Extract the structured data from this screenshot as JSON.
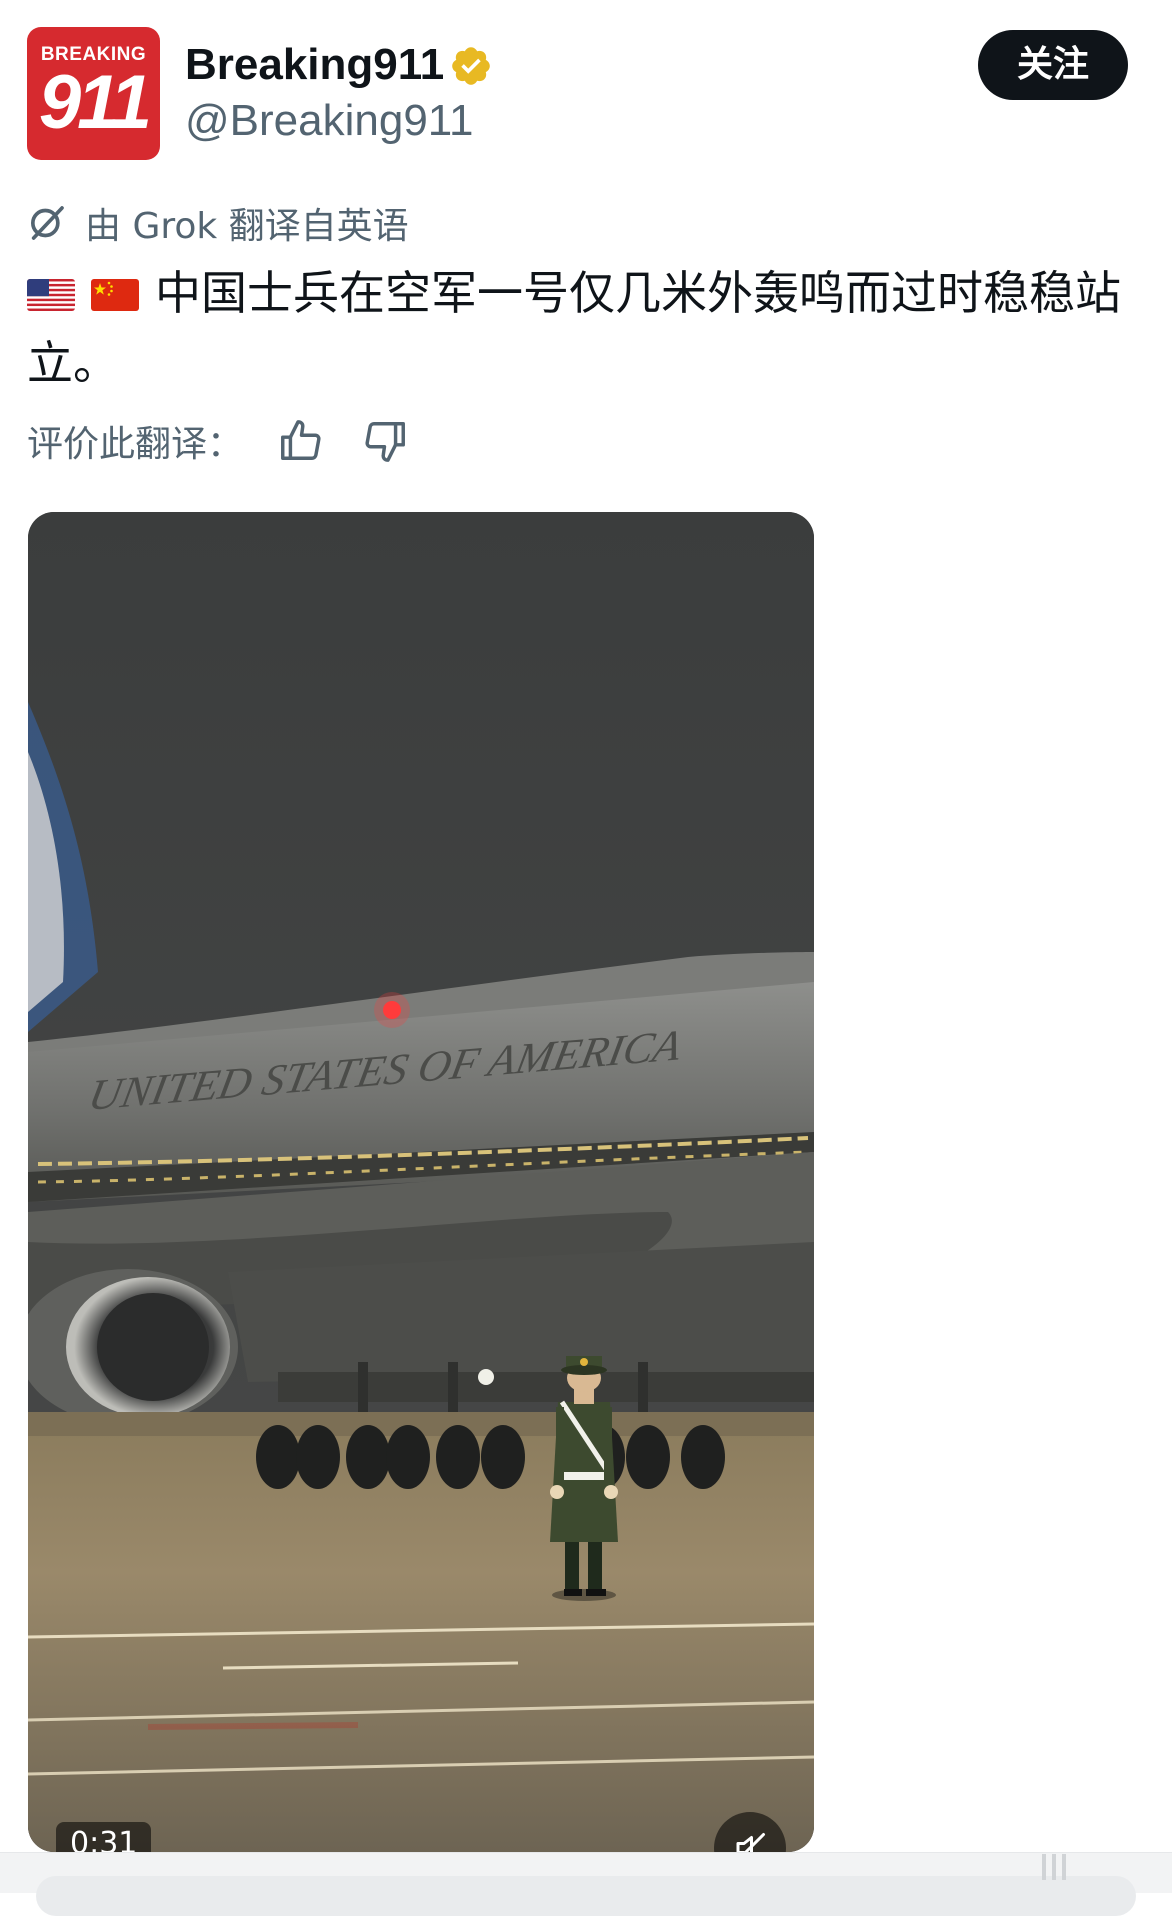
{
  "author": {
    "avatar": {
      "line1": "BREAKING",
      "line2": "911",
      "color": "#d62a2f"
    },
    "display_name": "Breaking911",
    "handle": "@Breaking911",
    "verified": true,
    "verified_icon": "verified-badge-icon",
    "badge_color": "#e8b923"
  },
  "follow_button": {
    "label": "关注"
  },
  "translation": {
    "notice": "由 Grok 翻译自英语",
    "icon": "grok-icon"
  },
  "tweet": {
    "flags": [
      "us-flag-icon",
      "cn-flag-icon"
    ],
    "text": "中国士兵在空军一号仅几米外轰鸣而过时稳稳站立。"
  },
  "rating": {
    "label": "评价此翻译：",
    "up_icon": "thumbs-up-icon",
    "down_icon": "thumbs-down-icon"
  },
  "video": {
    "aircraft_text": "UNITED STATES OF AMERICA",
    "duration": "0:31",
    "mute_icon": "muted-speaker-icon"
  },
  "theme": {
    "text_primary": "#0f1419",
    "text_secondary": "#536471",
    "button_bg": "#0f1419"
  }
}
